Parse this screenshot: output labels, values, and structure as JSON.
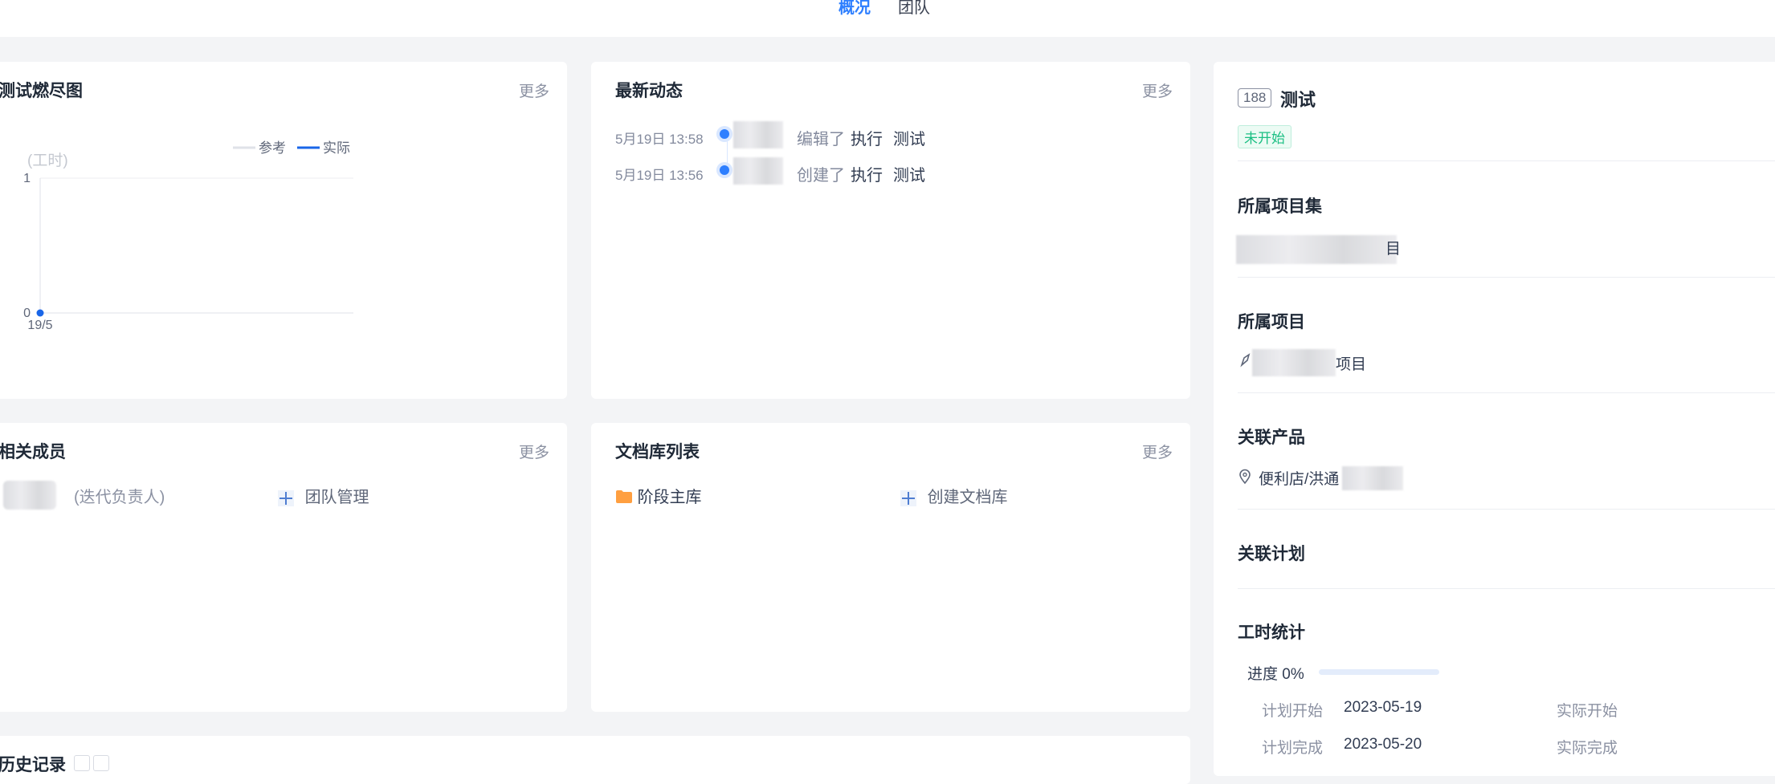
{
  "tabs": [
    {
      "label": "概况",
      "active": true
    },
    {
      "label": "团队",
      "active": false
    }
  ],
  "burndown": {
    "title": "测试燃尽图",
    "more": "更多"
  },
  "chart_data": {
    "type": "line",
    "title": "测试燃尽图",
    "ylabel": "(工时)",
    "xlabel": "",
    "x": [
      "19/5"
    ],
    "ylim": [
      0,
      1
    ],
    "yticks": [
      "1",
      "0"
    ],
    "series": [
      {
        "name": "参考",
        "values": [],
        "color": "#dfe2e8"
      },
      {
        "name": "实际",
        "values": [
          0
        ],
        "color": "#1966e8"
      }
    ],
    "legend": "top-right",
    "grid": true
  },
  "dynamics": {
    "title": "最新动态",
    "more": "更多",
    "items": [
      {
        "time": "5月19日 13:58",
        "action": "编辑了",
        "type": "执行",
        "object": "测试"
      },
      {
        "time": "5月19日 13:56",
        "action": "创建了",
        "type": "执行",
        "object": "测试"
      }
    ]
  },
  "members": {
    "title": "相关成员",
    "more": "更多",
    "owner_role": "(迭代负责人)",
    "manage_label": "团队管理"
  },
  "doclibs": {
    "title": "文档库列表",
    "more": "更多",
    "library": "阶段主库",
    "create_label": "创建文档库"
  },
  "history": {
    "title": "历史记录"
  },
  "side": {
    "id": "188",
    "name": "测试",
    "status": "未开始",
    "program_label": "所属项目集",
    "program_value_suffix": "目",
    "project_label": "所属项目",
    "project_value_suffix": "项目",
    "product_label": "关联产品",
    "product_value": "便利店/洪通",
    "plan_label": "关联计划",
    "hours_label": "工时统计",
    "progress_text": "进度 0%",
    "progress": 0,
    "plan_start_label": "计划开始",
    "plan_start_value": "2023-05-19",
    "plan_end_label": "计划完成",
    "plan_end_value": "2023-05-20",
    "real_start_label": "实际开始",
    "real_end_label": "实际完成"
  },
  "colors": {
    "accent": "#2e7fff",
    "status_green": "#1bbf83",
    "folder": "#ff9f40"
  }
}
